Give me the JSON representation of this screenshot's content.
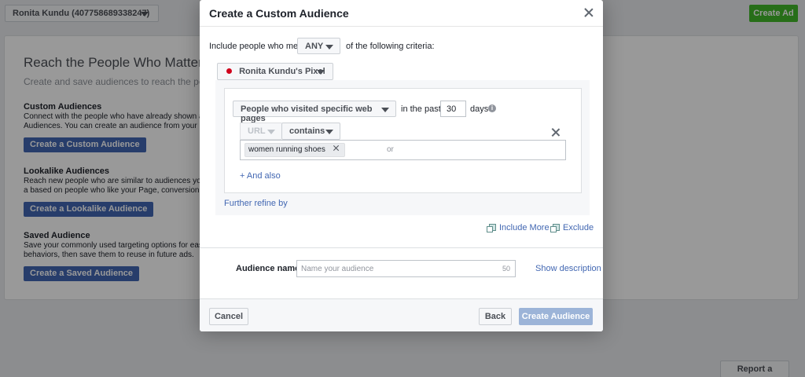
{
  "topbar": {
    "account_label": "Ronita Kundu (407758689338247)",
    "create_ad_label": "Create Ad"
  },
  "background": {
    "heading": "Reach the People Who Matter to",
    "subheading": "Create and save audiences to reach the peop",
    "sections": [
      {
        "title": "Custom Audiences",
        "text": "Connect with the people who have already shown an Audiences. You can create an audience from your cus",
        "button": "Create a Custom Audience"
      },
      {
        "title": "Lookalike Audiences",
        "text": "Reach new people who are similar to audiences you a based on people who like your Page, conversion pixe",
        "button": "Create a Lookalike Audience"
      },
      {
        "title": "Saved Audience",
        "text": "Save your commonly used targeting options for easy behaviors, then save them to reuse in future ads.",
        "button": "Create a Saved Audience"
      }
    ],
    "report_problem_label": "Report a Problem"
  },
  "modal": {
    "title": "Create a Custom Audience",
    "criteria": {
      "prefix": "Include people who meet",
      "match_value": "ANY",
      "suffix": "of the following criteria:"
    },
    "pixel": {
      "label": "Ronita Kundu's Pixel",
      "status_color": "#d0021b"
    },
    "rule": {
      "visitor_option": "People who visited specific web pages",
      "in_the_past_label": "in the past",
      "days_value": "30",
      "days_label": "days",
      "info_icon_glyph": "i",
      "url_field_label": "URL",
      "operator": "contains",
      "keywords": [
        "women running shoes"
      ],
      "or_placeholder": "or",
      "and_also_label": "+ And also"
    },
    "further_refine_label": "Further refine by",
    "include_more_label": "Include More",
    "exclude_label": "Exclude",
    "audience_name": {
      "label": "Audience name",
      "placeholder": "Name your audience",
      "char_count": "50",
      "show_description_label": "Show description"
    },
    "footer": {
      "cancel_label": "Cancel",
      "back_label": "Back",
      "create_label": "Create Audience"
    }
  },
  "colors": {
    "primary_blue": "#4267b2",
    "create_ad_green": "#42b72a",
    "disabled_blue": "#9cb4d8"
  }
}
